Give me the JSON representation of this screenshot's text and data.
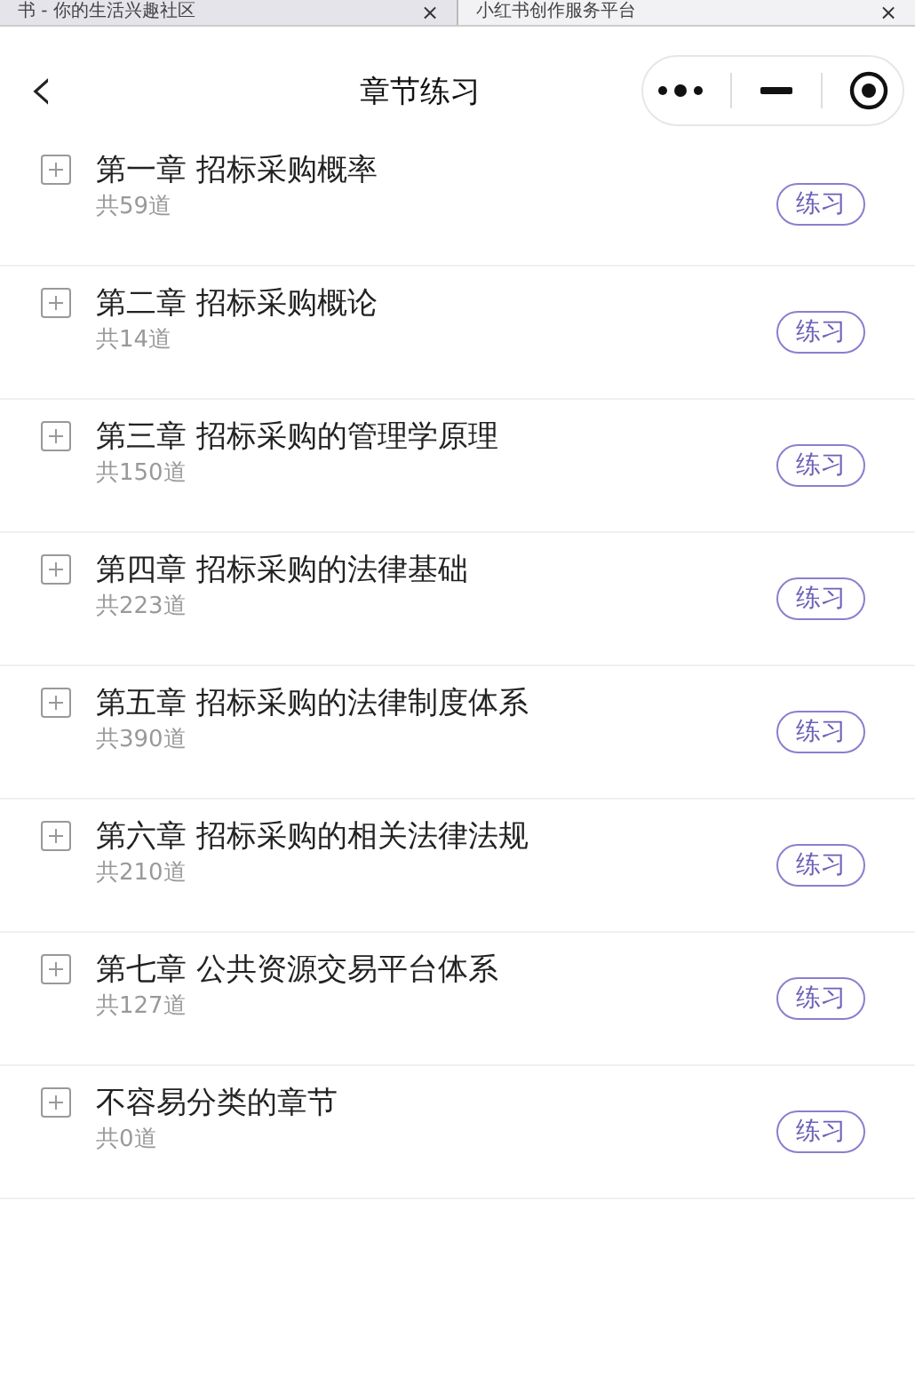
{
  "browser_tabs": [
    {
      "title": "书 - 你的生活兴趣社区",
      "close": "×"
    },
    {
      "title": "小红书创作服务平台",
      "close": "×"
    }
  ],
  "header": {
    "back": "‹",
    "title": "章节练习"
  },
  "chapters": [
    {
      "title": "第一章 招标采购概率",
      "count": "共59道",
      "button": "练习"
    },
    {
      "title": "第二章 招标采购概论",
      "count": "共14道",
      "button": "练习"
    },
    {
      "title": "第三章 招标采购的管理学原理",
      "count": "共150道",
      "button": "练习"
    },
    {
      "title": "第四章 招标采购的法律基础",
      "count": "共223道",
      "button": "练习"
    },
    {
      "title": "第五章 招标采购的法律制度体系",
      "count": "共390道",
      "button": "练习"
    },
    {
      "title": "第六章 招标采购的相关法律法规",
      "count": "共210道",
      "button": "练习"
    },
    {
      "title": "第七章 公共资源交易平台体系",
      "count": "共127道",
      "button": "练习"
    },
    {
      "title": "不容易分类的章节",
      "count": "共0道",
      "button": "练习"
    }
  ]
}
